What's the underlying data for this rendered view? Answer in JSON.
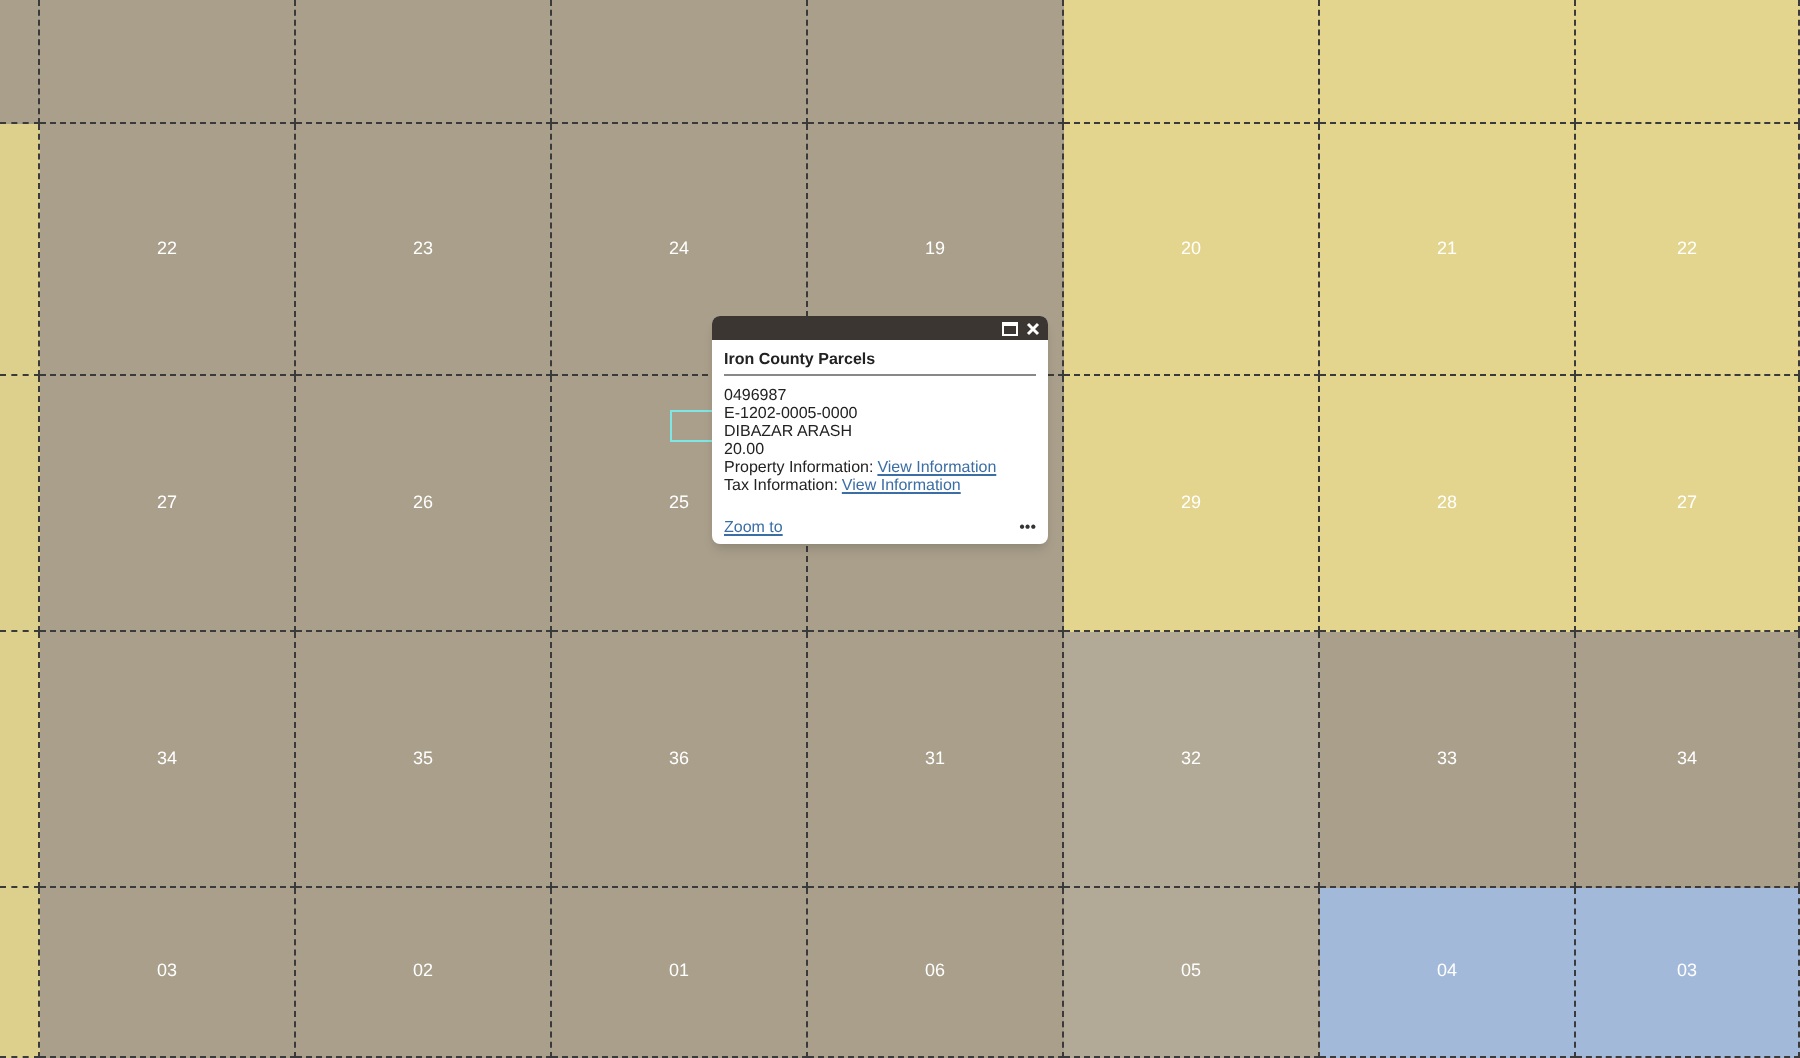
{
  "map": {
    "sections": [
      [
        {
          "label": "22",
          "color": "#a99f8b"
        },
        {
          "label": "23",
          "color": "#a99f8b"
        },
        {
          "label": "24",
          "color": "#a99f8b"
        },
        {
          "label": "19",
          "color": "#a99f8b"
        },
        {
          "label": "20",
          "color": "#e4d58e"
        },
        {
          "label": "21",
          "color": "#e4d58e"
        },
        {
          "label": "22",
          "color": "#e4d58e"
        }
      ],
      [
        {
          "label": "27",
          "color": "#a99f8b"
        },
        {
          "label": "26",
          "color": "#a99f8b"
        },
        {
          "label": "25",
          "color": "#a99f8b"
        },
        {
          "color": "#a99f8b"
        },
        {
          "label": "29",
          "color": "#e4d58e"
        },
        {
          "label": "28",
          "color": "#e4d58e"
        },
        {
          "label": "27",
          "color": "#e4d58e"
        }
      ],
      [
        {
          "label": "34",
          "color": "#a99f8b"
        },
        {
          "label": "35",
          "color": "#a99f8b"
        },
        {
          "label": "36",
          "color": "#a99f8b"
        },
        {
          "label": "31",
          "color": "#a99f8b"
        },
        {
          "label": "32",
          "color": "#b2a996"
        },
        {
          "label": "33",
          "color": "#a99f8b"
        },
        {
          "label": "34",
          "color": "#a99f8b"
        }
      ],
      [
        {
          "label": "03",
          "color": "#a99f8b"
        },
        {
          "label": "02",
          "color": "#a99f8b"
        },
        {
          "label": "01",
          "color": "#a99f8b"
        },
        {
          "label": "06",
          "color": "#a99f8b"
        },
        {
          "label": "05",
          "color": "#b2a996"
        },
        {
          "label": "04",
          "color": "#a3b9d9"
        },
        {
          "label": "03",
          "color": "#a3b9d9"
        }
      ]
    ]
  },
  "popup": {
    "title": "Iron County Parcels",
    "lines": [
      {
        "kind": "text",
        "text": "0496987"
      },
      {
        "kind": "text",
        "text": "E-1202-0005-0000"
      },
      {
        "kind": "text",
        "text": "DIBAZAR ARASH"
      },
      {
        "kind": "text",
        "text": "20.00"
      },
      {
        "kind": "link",
        "label": "Property Information:",
        "link": "View Information"
      },
      {
        "kind": "link",
        "label": "Tax Information:",
        "link": "View Information"
      }
    ],
    "zoom_link": "Zoom to",
    "menu": "•••"
  }
}
